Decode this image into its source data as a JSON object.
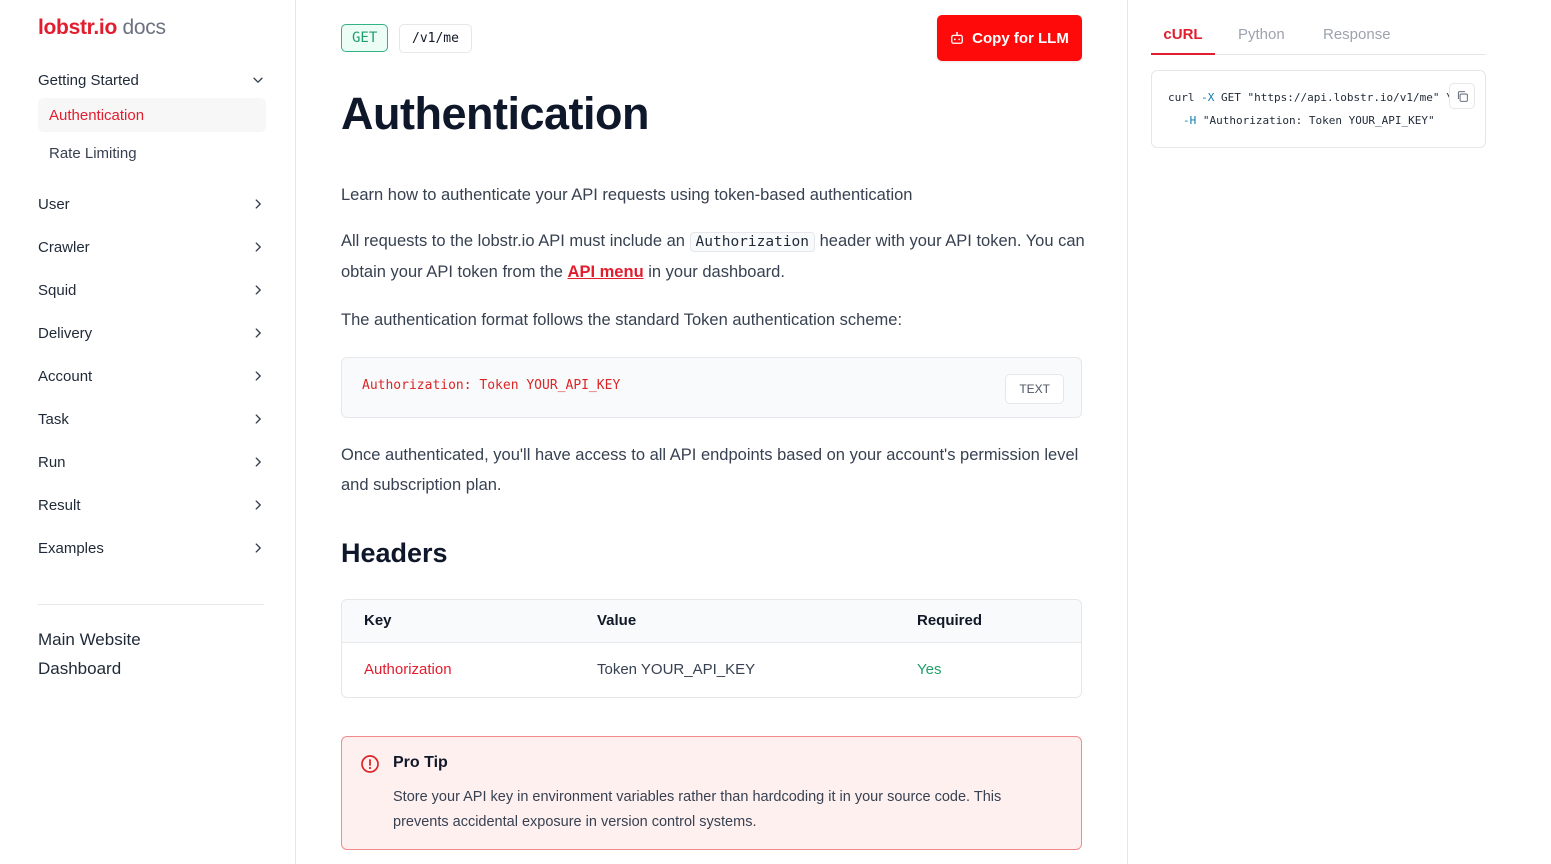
{
  "sidebar": {
    "logo_brand": "lobstr.io",
    "logo_suffix": "docs",
    "getting_started": "Getting Started",
    "sub_items": [
      "Authentication",
      "Rate Limiting"
    ],
    "groups": [
      "User",
      "Crawler",
      "Squid",
      "Delivery",
      "Account",
      "Task",
      "Run",
      "Result",
      "Examples"
    ],
    "links": [
      "Main Website",
      "Dashboard"
    ]
  },
  "header": {
    "method": "GET",
    "path": "/v1/me",
    "copy_button": "Copy for LLM"
  },
  "content": {
    "title": "Authentication",
    "intro": "Learn how to authenticate your API requests using token-based authentication",
    "p1_before": "All requests to the lobstr.io API must include an ",
    "p1_code": "Authorization",
    "p1_mid": " header with your API token. You can obtain your API token from the ",
    "p1_link": "API menu",
    "p1_after": " in your dashboard.",
    "p2": "The authentication format follows the standard Token authentication scheme:",
    "code_sample": "Authorization: Token YOUR_API_KEY",
    "code_lang": "TEXT",
    "p3": "Once authenticated, you'll have access to all API endpoints based on your account's permission level and subscription plan.",
    "headers_title": "Headers",
    "table": {
      "columns": [
        "Key",
        "Value",
        "Required"
      ],
      "rows": [
        {
          "key": "Authorization",
          "value": "Token YOUR_API_KEY",
          "required": "Yes"
        }
      ]
    },
    "tip": {
      "title": "Pro Tip",
      "body": "Store your API key in environment variables rather than hardcoding it in your source code. This prevents accidental exposure in version control systems."
    }
  },
  "right_panel": {
    "tabs": [
      "cURL",
      "Python",
      "Response"
    ],
    "active_tab": "cURL",
    "snippet": {
      "line1_cmd": "curl ",
      "line1_flag": "-X",
      "line1_rest": " GET \"https://api.lobstr.io/v1/me\" \\",
      "line2_flag": "-H",
      "line2_rest": " \"Authorization: Token YOUR_API_KEY\""
    }
  },
  "colors": {
    "accent": "#e11d2e",
    "button": "#ff0a0a",
    "success": "#22a06b"
  },
  "icons": {
    "nav_expanded": "chevron-down-icon",
    "nav_collapsed": "chevron-right-icon",
    "copy_llm": "robot-icon",
    "tip": "info-circle-icon",
    "snippet_copy": "copy-icon"
  }
}
